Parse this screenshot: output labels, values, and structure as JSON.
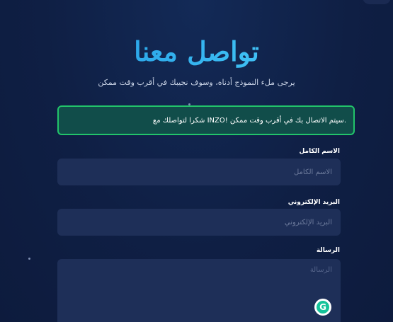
{
  "header": {
    "title": "تواصل معنا",
    "subtitle": "يرجى ملء النموذج أدناه، وسوف نجيبك في أقرب وقت ممكن"
  },
  "alert": {
    "message": ".سيتم الاتصال بك في أقرب وقت ممكن !INZO شكرا لتواصلك مع",
    "accent_color": "#22c46a"
  },
  "form": {
    "name": {
      "label": "الاسم الكامل",
      "placeholder": "الاسم الكامل",
      "value": ""
    },
    "email": {
      "label": "البريد الإلكتروني",
      "placeholder": "البريد الإلكتروني",
      "value": ""
    },
    "message": {
      "label": "الرسالة",
      "placeholder": "الرسالة",
      "value": ""
    }
  },
  "extension": {
    "icon": "grammarly-icon",
    "glyph": "G"
  },
  "colors": {
    "background": "#0f1f44",
    "input_background": "#1e2f58",
    "title_gradient_start": "#1a8fe0",
    "title_gradient_end": "#5fd4ff"
  }
}
